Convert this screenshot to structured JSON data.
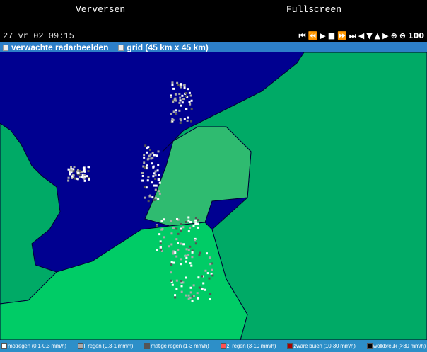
{
  "header": {
    "refresh": "Verversen",
    "fullscreen": "Fullscreen"
  },
  "time": "27 vr 02 09:15",
  "controls": [
    {
      "icon": "first-frame-icon",
      "glyph": "⏮"
    },
    {
      "icon": "rewind-icon",
      "glyph": "⏪"
    },
    {
      "icon": "play-icon",
      "glyph": "▶"
    },
    {
      "icon": "stop-icon",
      "glyph": "■"
    },
    {
      "icon": "fast-forward-icon",
      "glyph": "⏩"
    },
    {
      "icon": "last-frame-icon",
      "glyph": "⏭"
    },
    {
      "icon": "pan-left-icon",
      "glyph": "◀"
    },
    {
      "icon": "pan-down-icon",
      "glyph": "▼"
    },
    {
      "icon": "pan-up-icon",
      "glyph": "▲"
    },
    {
      "icon": "pan-right-icon",
      "glyph": "▶"
    },
    {
      "icon": "zoom-in-icon",
      "glyph": "⊕"
    },
    {
      "icon": "zoom-out-icon",
      "glyph": "⊖"
    }
  ],
  "zoom": "100",
  "options": {
    "forecast": "verwachte radarbeelden",
    "grid": "grid (45 km x 45 km)"
  },
  "legend": [
    {
      "label": "motregen (0.1-0.3 mm/h)",
      "color": "#ffffff"
    },
    {
      "label": "l. regen (0.3-1 mm/h)",
      "color": "#aaaaaa"
    },
    {
      "label": "matige regen (1-3 mm/h)",
      "color": "#555555"
    },
    {
      "label": "z. regen (3-10 mm/h)",
      "color": "#ff5050"
    },
    {
      "label": "zware buien (10-30 mm/h)",
      "color": "#aa0000"
    },
    {
      "label": "wolkbreuk (>30 mm/h)",
      "color": "#000000"
    }
  ],
  "colors": {
    "sea": "#000090",
    "land": "#00aa66",
    "netherlands": "#2fbb70",
    "belgium": "#00cc66"
  }
}
